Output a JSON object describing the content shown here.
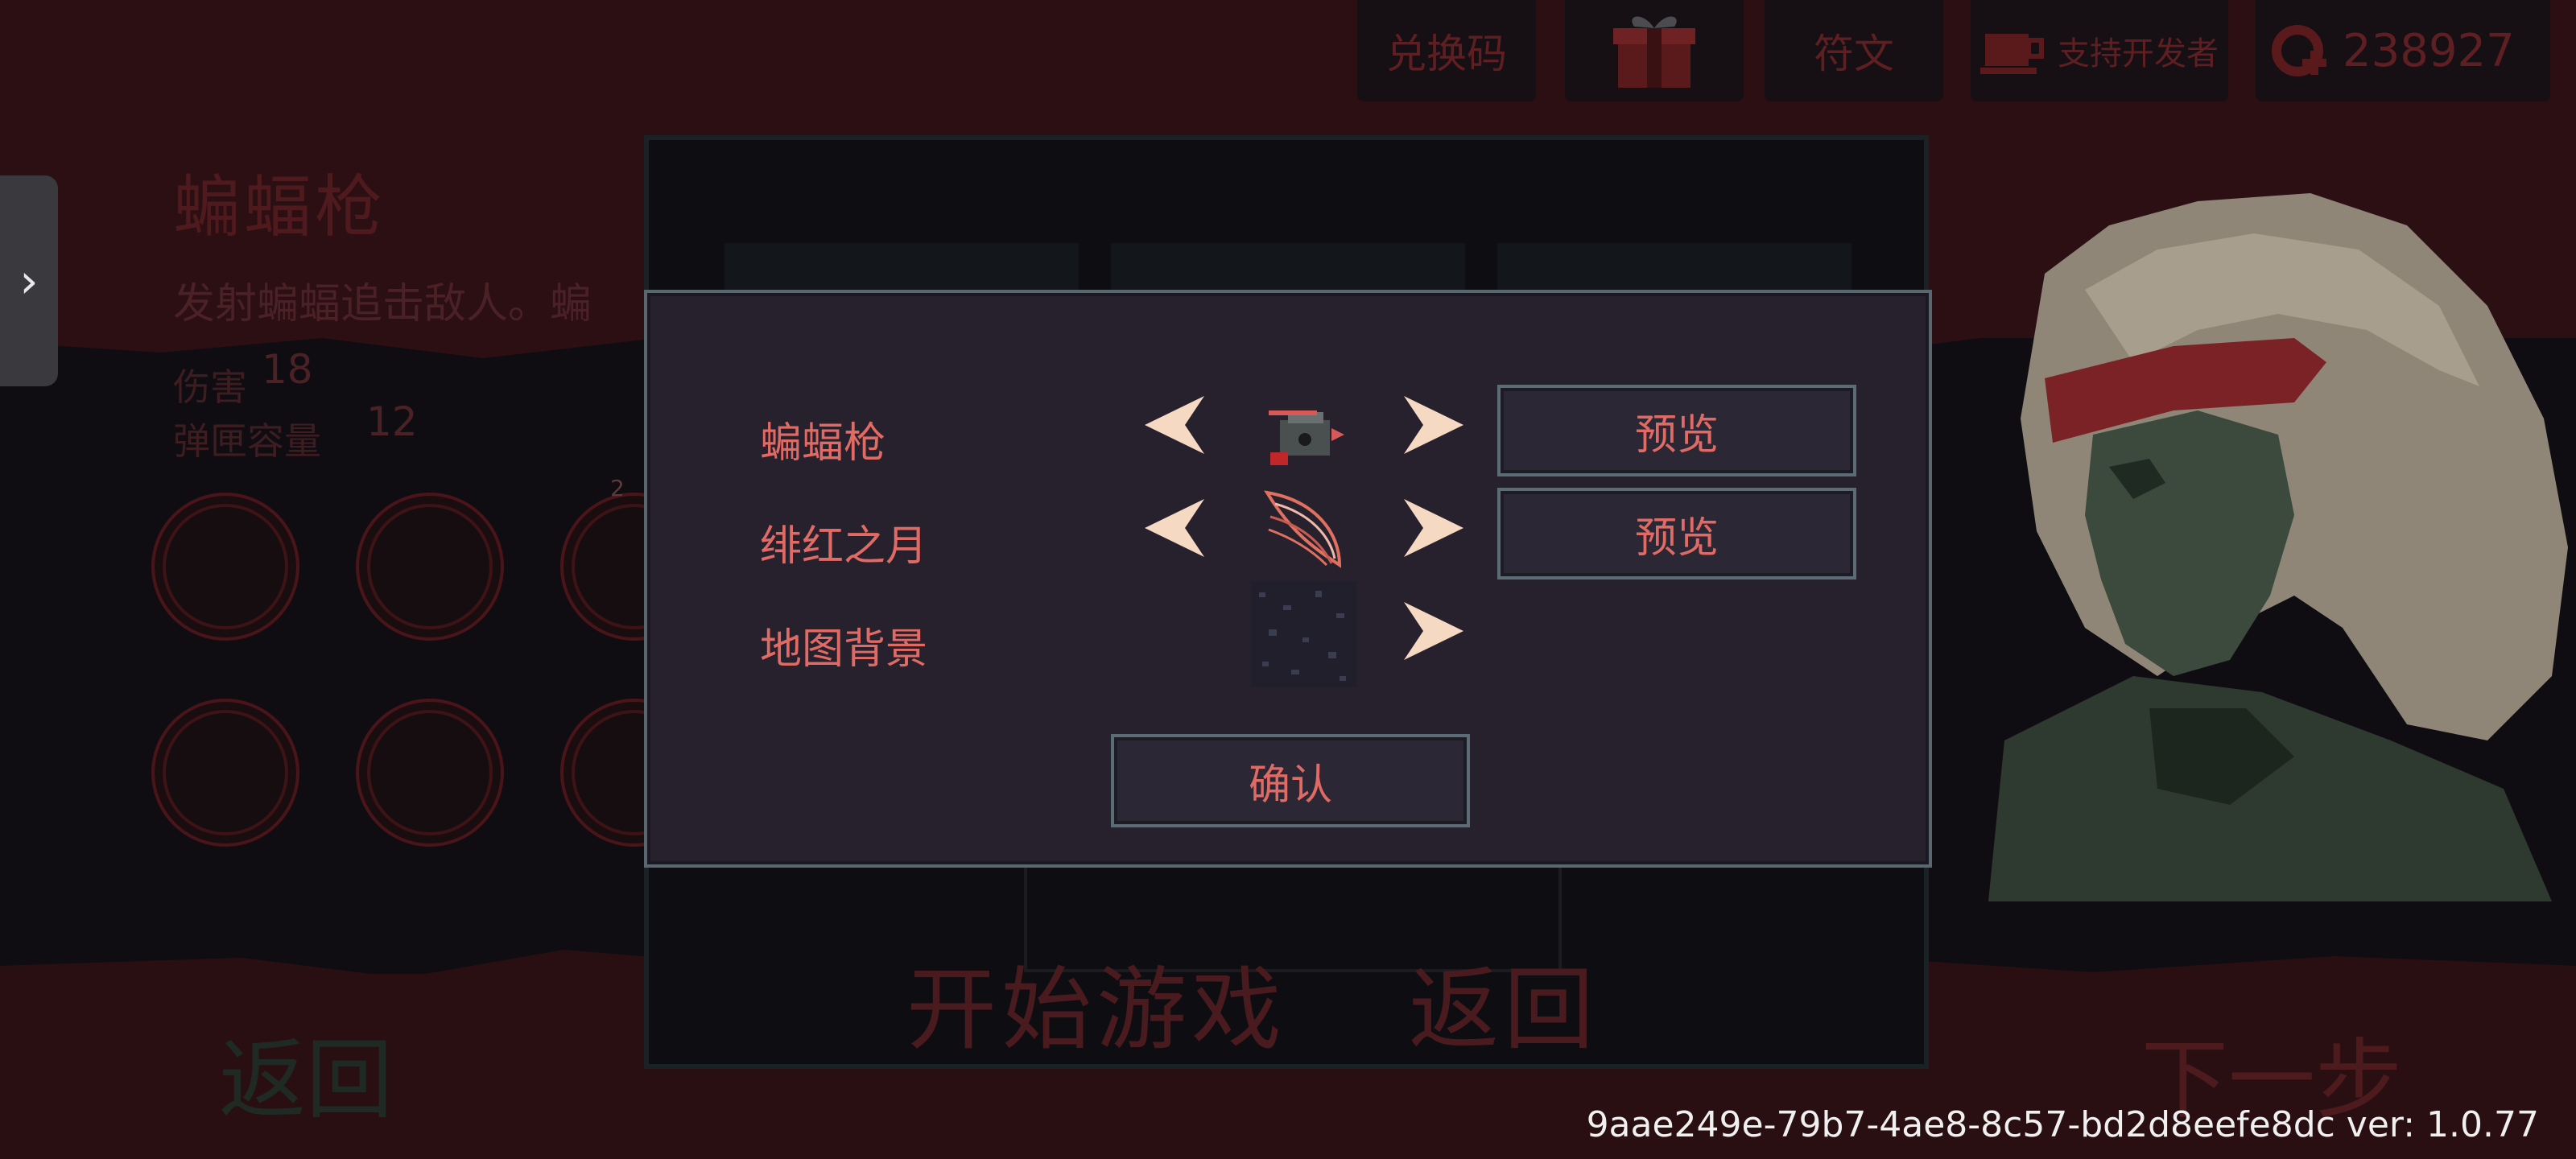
{
  "topbar": {
    "redeem_label": "兑换码",
    "runes_label": "符文",
    "support_label": "支持开发者",
    "currency_amount": "238927",
    "icons": [
      "gift-icon",
      "coffee-icon",
      "currency-icon"
    ]
  },
  "weapon_panel": {
    "title": "蝙蝠枪",
    "description": "发射蝙蝠追击敌人。蝙",
    "stats": [
      {
        "label": "伤害",
        "value": "18"
      },
      {
        "label": "弹匣容量",
        "value": "12"
      }
    ],
    "slot_badge": "2"
  },
  "background_menu": {
    "start_label": "开始游戏",
    "back_label": "返回",
    "left_back_label": "返回",
    "next_label": "下一步"
  },
  "dialog": {
    "rows": [
      {
        "label": "蝙蝠枪",
        "preview_label": "预览",
        "thumb": "bat-gun-icon"
      },
      {
        "label": "绯红之月",
        "preview_label": "预览",
        "thumb": "crimson-moon-wing-icon"
      },
      {
        "label": "地图背景",
        "thumb": "map-background-icon"
      }
    ],
    "confirm_label": "确认"
  },
  "footer": {
    "version_text": "9aae249e-79b7-4ae8-8c57-bd2d8eefe8dc ver: 1.0.77"
  },
  "colors": {
    "accent_red": "#e06a64",
    "arrow_cream": "#f5d9c2",
    "dialog_bg": "#27212e",
    "border": "#5a6670"
  }
}
